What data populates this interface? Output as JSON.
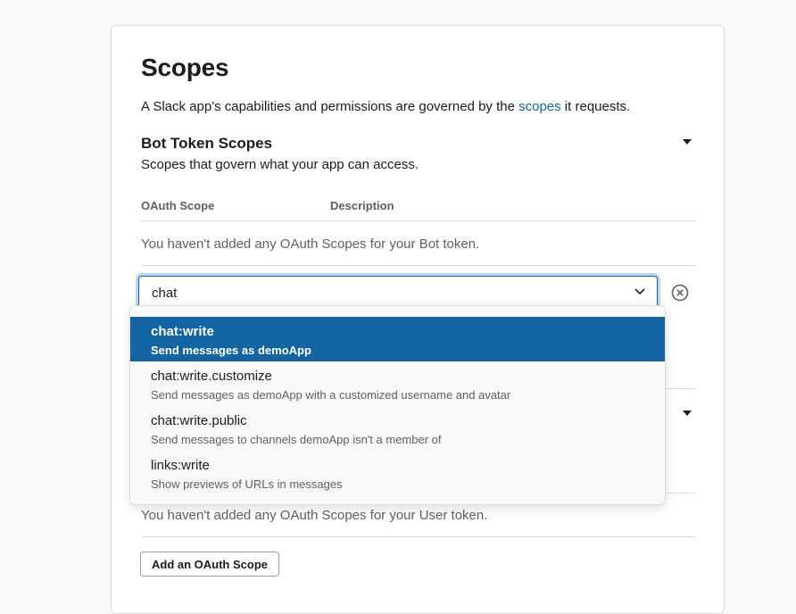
{
  "page": {
    "title": "Scopes"
  },
  "intro": {
    "before": "A Slack app's capabilities and permissions are governed by the ",
    "link": "scopes",
    "after": " it requests."
  },
  "bot": {
    "title": "Bot Token Scopes",
    "subtitle": "Scopes that govern what your app can access.",
    "columns": [
      "OAuth Scope",
      "Description"
    ],
    "empty_text": "You haven't added any OAuth Scopes for your Bot token."
  },
  "search": {
    "value": "chat",
    "placeholder": ""
  },
  "options": [
    {
      "name": "chat:write",
      "desc": "Send messages as demoApp",
      "selected": true
    },
    {
      "name": "chat:write.customize",
      "desc": "Send messages as demoApp with a customized username and avatar",
      "selected": false
    },
    {
      "name": "chat:write.public",
      "desc": "Send messages to channels demoApp isn't a member of",
      "selected": false
    },
    {
      "name": "links:write",
      "desc": "Show previews of URLs in messages",
      "selected": false
    }
  ],
  "user": {
    "empty_text": "You haven't added any OAuth Scopes for your User token.",
    "add_button": "Add an OAuth Scope"
  },
  "colors": {
    "accent": "#1264a3",
    "focus_ring": "#b9d6ee"
  },
  "icons": {
    "collapse": "caret-down-icon",
    "dropdown": "chevron-down-icon",
    "clear": "clear-circle-x-icon"
  }
}
